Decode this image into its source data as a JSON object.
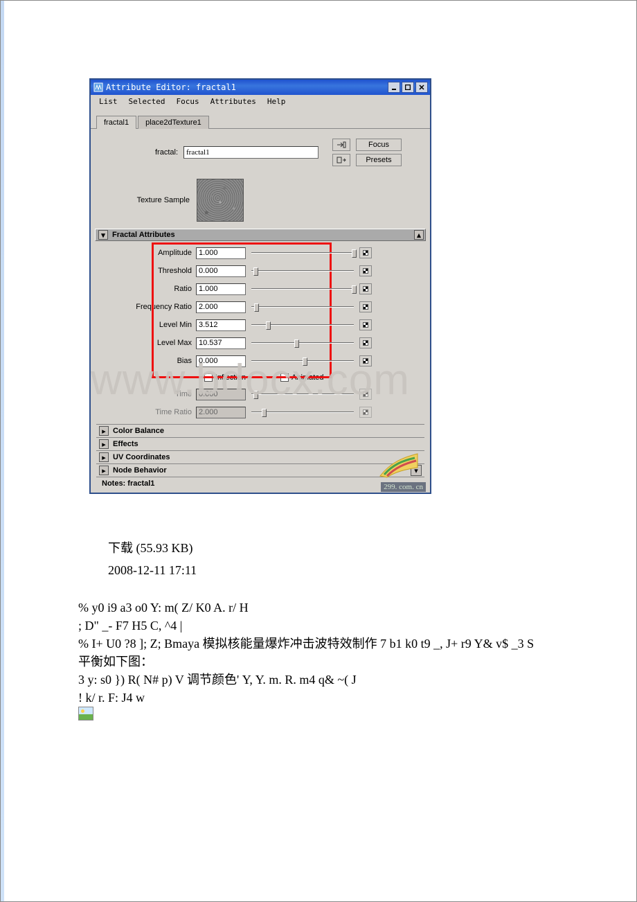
{
  "window": {
    "title": "Attribute Editor: fractal1",
    "menu": [
      "List",
      "Selected",
      "Focus",
      "Attributes",
      "Help"
    ],
    "tabs": [
      {
        "label": "fractal1",
        "active": true
      },
      {
        "label": "place2dTexture1",
        "active": false
      }
    ],
    "node_type_label": "fractal:",
    "node_name": "fractal1",
    "focus_label": "Focus",
    "presets_label": "Presets",
    "sample_label": "Texture Sample",
    "fractal_section": "Fractal Attributes",
    "attrs": [
      {
        "label": "Amplitude",
        "value": "1.000",
        "pos": 98,
        "enabled": true
      },
      {
        "label": "Threshold",
        "value": "0.000",
        "pos": 2,
        "enabled": true
      },
      {
        "label": "Ratio",
        "value": "1.000",
        "pos": 98,
        "enabled": true
      },
      {
        "label": "Frequency Ratio",
        "value": "2.000",
        "pos": 3,
        "enabled": true
      },
      {
        "label": "Level Min",
        "value": "3.512",
        "pos": 14,
        "enabled": true
      },
      {
        "label": "Level Max",
        "value": "10.537",
        "pos": 42,
        "enabled": true
      },
      {
        "label": "Bias",
        "value": "0.000",
        "pos": 50,
        "enabled": true
      }
    ],
    "inflection_label": "Inflection",
    "animated_label": "Animated",
    "time_attrs": [
      {
        "label": "Time",
        "value": "0.000",
        "pos": 2,
        "enabled": false
      },
      {
        "label": "Time Ratio",
        "value": "2.000",
        "pos": 10,
        "enabled": false
      }
    ],
    "collapsed": [
      "Color Balance",
      "Effects",
      "UV Coordinates",
      "Node Behavior"
    ],
    "notes_label": "Notes: fractal1",
    "stamp": "299. com. cn"
  },
  "watermark": "www.bdocx.com",
  "below": {
    "line1": "下载 (55.93 KB)",
    "line2": "2008-12-11 17:11"
  },
  "code": {
    "l1": "% y0 i9 a3 o0 Y: m( Z/ K0 A. r/ H",
    "l2": "; D\" _- F7 H5 C, ^4 |",
    "l3": "% I+ U0 ?8 ]; Z; Bmaya 模拟核能量爆炸冲击波特效制作 7 b1 k0 t9 _, J+ r9 Y& v$ _3 S",
    "l4": "平衡如下图：",
    "l5": "3 y: s0 }) R( N# p) V 调节颜色' Y, Y. m. R. m4 q& ~( J",
    "l6": "! k/ r. F: J4 w"
  }
}
